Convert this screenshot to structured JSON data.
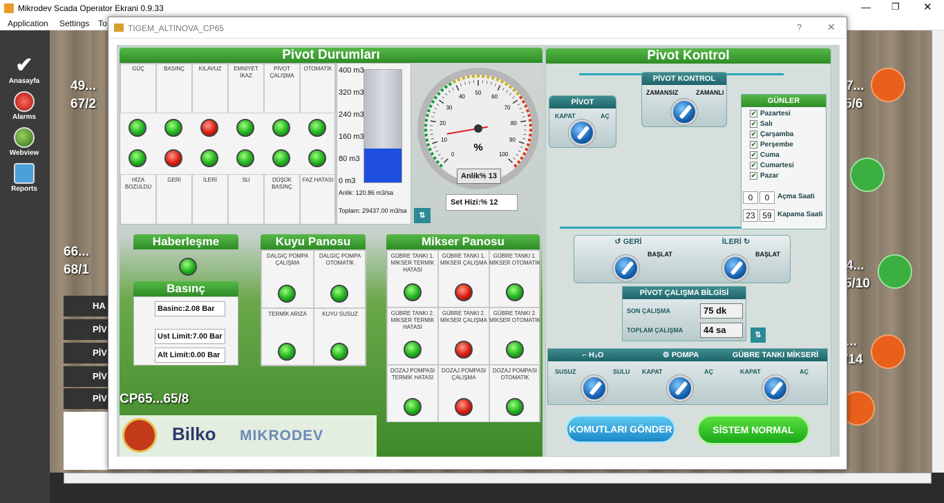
{
  "app": {
    "title": "Mikrodev Scada Operator Ekrani 0.9.33",
    "menu": [
      "Application",
      "Settings",
      "To"
    ]
  },
  "nav": [
    {
      "label": "Anasayfa",
      "icon": "check-icon"
    },
    {
      "label": "Alarms",
      "icon": "alarm-icon"
    },
    {
      "label": "Webview",
      "icon": "globe-icon"
    },
    {
      "label": "Reports",
      "icon": "reports-icon"
    }
  ],
  "map": {
    "labels": [
      "49...",
      "67/2",
      "66...",
      "68/1",
      "7...",
      "5/6",
      "4...",
      "5/10",
      "...",
      "/14"
    ],
    "legend": [
      "HA",
      "PİV",
      "PİV",
      "PİV",
      "PİV"
    ]
  },
  "dialog": {
    "title": "TIGEM_ALTINOVA_CP65",
    "help": "?",
    "close": "✕"
  },
  "pivot_status": {
    "title": "Pivot Durumları",
    "top_labels": [
      "GÜÇ",
      "BASINÇ",
      "KILAVUZ",
      "EMNİYET İKAZ",
      "PİVOT ÇALIŞMA",
      "OTOMATİK"
    ],
    "row1": [
      "g",
      "g",
      "r",
      "g",
      "g",
      "g"
    ],
    "row2": [
      "g",
      "r",
      "g",
      "g",
      "g",
      "g"
    ],
    "bottom_labels": [
      "HİZA BOZULDU",
      "GERİ",
      "İLERİ",
      "SU",
      "DÜŞÜK BASINÇ",
      "FAZ HATASI"
    ],
    "tank_ticks": [
      "400 m3",
      "320 m3",
      "240 m3",
      "160 m3",
      "80 m3",
      "0 m3"
    ],
    "tank_level": 0.3,
    "anlik": "Anlik: 120.86 m3/sa",
    "toplam": "Toplam: 29437.00 m3/sa",
    "gauge_unit": "%",
    "gauge_ticks": [
      "0",
      "10",
      "20",
      "30",
      "40",
      "50",
      "60",
      "70",
      "80",
      "90",
      "100"
    ],
    "gauge_value": 13,
    "anlik_pct": "Anlik% 13",
    "set_hizi": "Set Hizi:% 12"
  },
  "haberlesme": {
    "title": "Haberleşme"
  },
  "basinc": {
    "title": "Basınç",
    "basinc": "Basinc:2.08 Bar",
    "ust": "Ust Limit:7.00 Bar",
    "alt": "Alt Limit:0.00 Bar"
  },
  "kuyu": {
    "title": "Kuyu Panosu",
    "labels": [
      "DALGIÇ POMPA ÇALIŞMA",
      "DALGIÇ POMPA OTOMATİK",
      "TERMİK ARIZA",
      "KUYU SUSUZ"
    ]
  },
  "mikser": {
    "title": "Mikser Panosu",
    "labels": [
      "GÜBRE TANKI 1. MİKSER TERMİK HATASI",
      "GÜBRE TANKI 1. MİKSER ÇALIŞMA",
      "GÜBRE TANKI 1. MİKSER OTOMATİK",
      "GÜBRE TANKI 2. MİKSER TERMİK HATASI",
      "GÜBRE TANKI 2. MİKSER ÇALIŞMA",
      "GÜBRE TANKI 2. MİKSER OTOMATİK",
      "DOZAJ POMPASI TERMİK HATASI",
      "DOZAJ POMPASI ÇALIŞMA",
      "DOZAJ POMPASI OTOMATİK"
    ],
    "leds": [
      "g",
      "r",
      "g",
      "g",
      "r",
      "g",
      "g",
      "r",
      "g"
    ]
  },
  "station": "CP65...65/8",
  "brands": [
    "Bilko",
    "MIKRODEV"
  ],
  "control": {
    "title": "Pivot Kontrol",
    "pivot": {
      "title": "PİVOT",
      "left": "KAPAT",
      "right": "AÇ"
    },
    "pk": {
      "title": "PİVOT KONTROL",
      "left": "ZAMANSIZ",
      "right": "ZAMANLI"
    },
    "gunler": {
      "title": "GÜNLER",
      "days": [
        "Pazartesi",
        "Salı",
        "Çarşamba",
        "Perşembe",
        "Cuma",
        "Cumartesi",
        "Pazar"
      ],
      "acma_h": "0",
      "acma_m": "0",
      "acma_label": "Açma Saati",
      "kapama_h": "23",
      "kapama_m": "59",
      "kapama_label": "Kapama Saati"
    },
    "geri": "GERİ",
    "ileri": "İLERİ",
    "baslat": "BAŞLAT",
    "bilgi": {
      "title": "PİVOT ÇALIŞMA BİLGİSİ",
      "son_label": "SON ÇALIŞMA",
      "son": "75 dk",
      "toplam_label": "TOPLAM ÇALIŞMA",
      "toplam": "44 sa"
    },
    "h2o": {
      "title": "H₂O",
      "left": "SUSUZ",
      "right": "SULU"
    },
    "pompa": {
      "title": "POMPA",
      "left": "KAPAT",
      "right": "AÇ"
    },
    "gubre": {
      "title": "GÜBRE TANKI MİKSERİ",
      "left": "KAPAT",
      "right": "AÇ"
    },
    "send": "KOMUTLARI GÖNDER",
    "normal": "SİSTEM NORMAL"
  }
}
